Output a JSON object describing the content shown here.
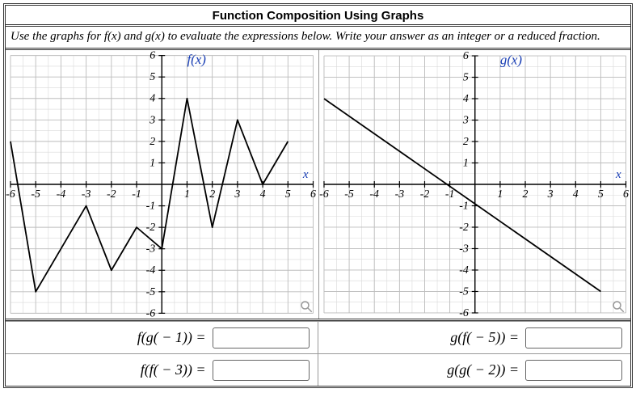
{
  "title": "Function Composition Using Graphs",
  "instructions_pre": "Use the graphs for ",
  "instructions_f": "f(x)",
  "instructions_mid": " and ",
  "instructions_g": "g(x)",
  "instructions_post": " to evaluate the expressions below. Write your answer as an integer or a reduced fraction.",
  "expr1": "f(g( − 1)) =",
  "expr2": "g(f( − 5)) =",
  "expr3": "f(f( − 3)) =",
  "expr4": "g(g( − 2)) =",
  "x_axis_label": "x",
  "f_label": "f(x)",
  "g_label": "g(x)",
  "chart_data": [
    {
      "type": "line",
      "name": "f(x)",
      "xlim": [
        -6,
        6
      ],
      "ylim": [
        -6,
        6
      ],
      "xticks": [
        -6,
        -5,
        -4,
        -3,
        -2,
        -1,
        1,
        2,
        3,
        4,
        5,
        6
      ],
      "yticks": [
        -6,
        -5,
        -4,
        -3,
        -2,
        -1,
        1,
        2,
        3,
        4,
        5,
        6
      ],
      "points": [
        [
          -6,
          2
        ],
        [
          -5,
          -5
        ],
        [
          -4,
          -3
        ],
        [
          -3,
          -1
        ],
        [
          -2,
          -4
        ],
        [
          -1,
          -2
        ],
        [
          0,
          -3
        ],
        [
          1,
          4
        ],
        [
          2,
          -2
        ],
        [
          3,
          3
        ],
        [
          4,
          0
        ],
        [
          5,
          2
        ]
      ]
    },
    {
      "type": "line",
      "name": "g(x)",
      "xlim": [
        -6,
        6
      ],
      "ylim": [
        -6,
        6
      ],
      "xticks": [
        -6,
        -5,
        -4,
        -3,
        -2,
        -1,
        1,
        2,
        3,
        4,
        5,
        6
      ],
      "yticks": [
        -6,
        -5,
        -4,
        -3,
        -2,
        -1,
        1,
        2,
        3,
        4,
        5,
        6
      ],
      "points": [
        [
          -6,
          4
        ],
        [
          5,
          -5
        ]
      ]
    }
  ]
}
